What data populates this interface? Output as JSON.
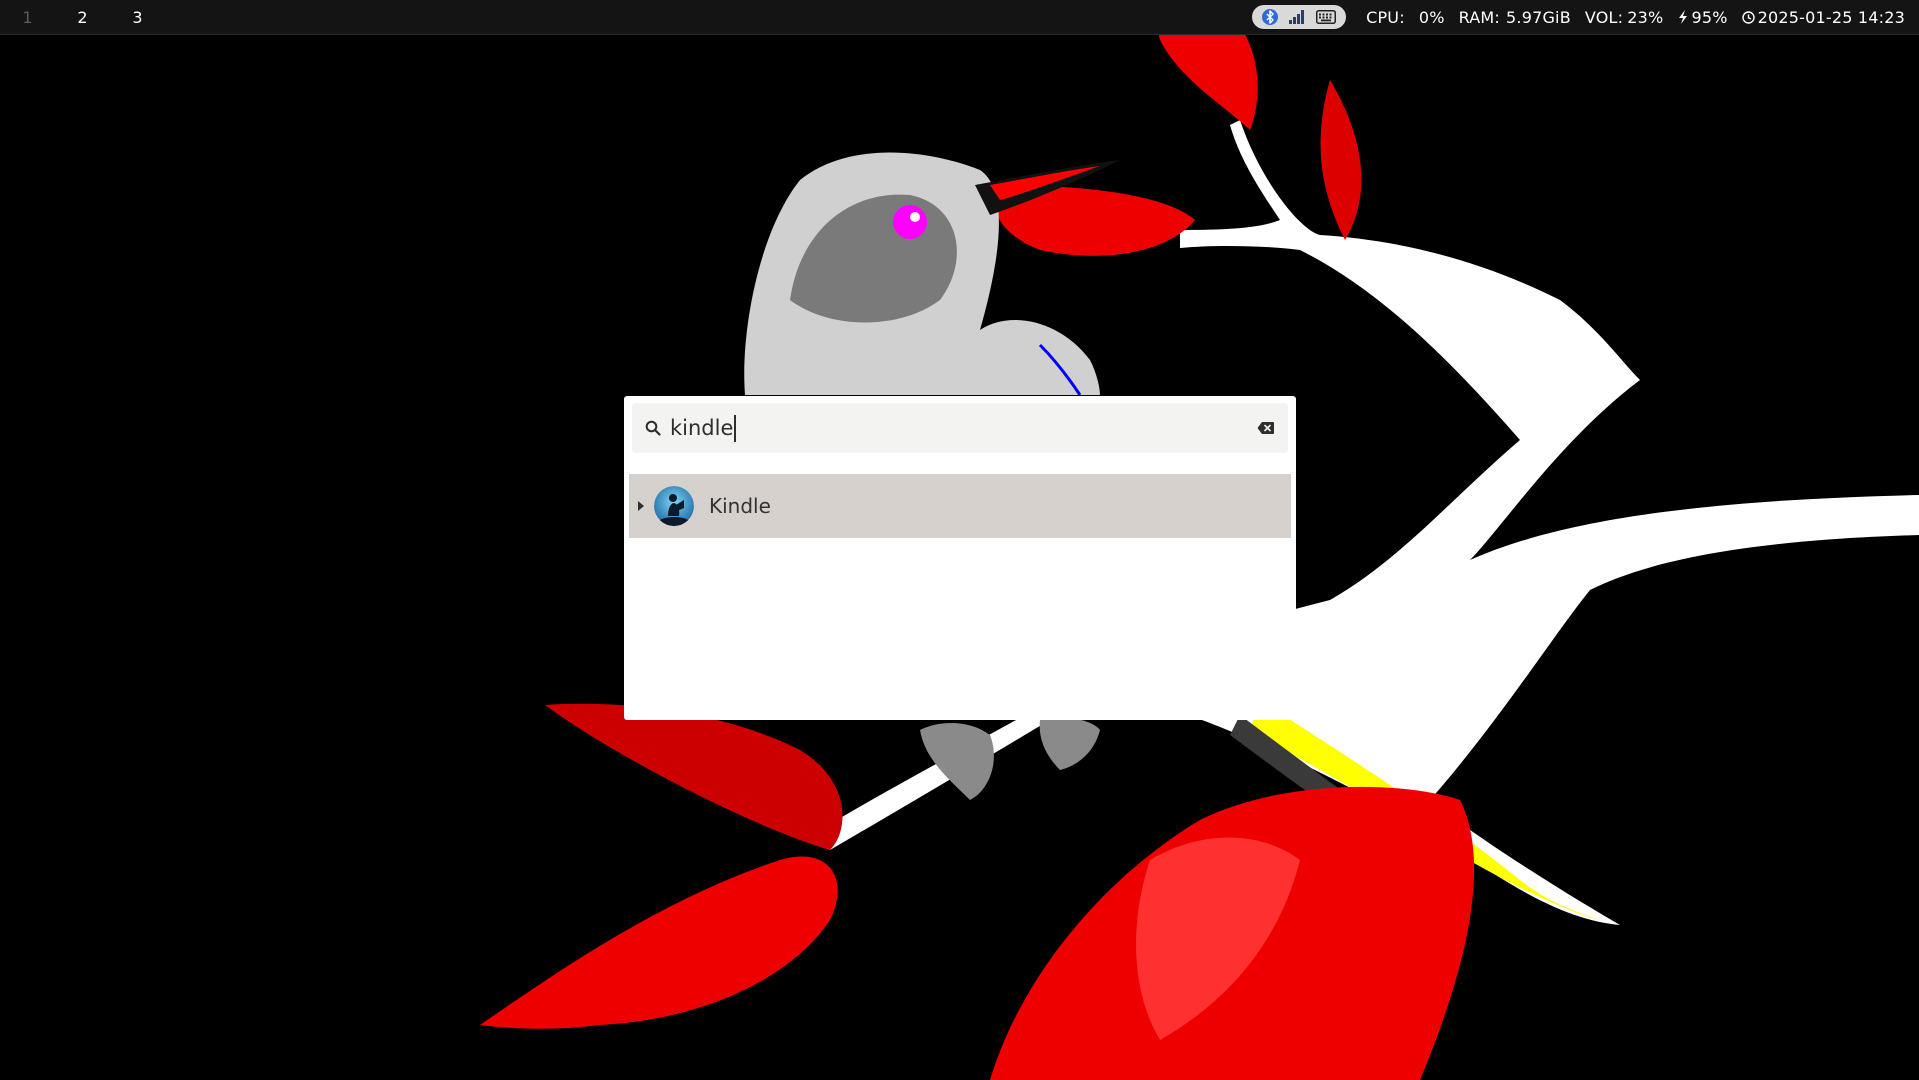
{
  "topbar": {
    "workspaces": [
      {
        "label": "1",
        "active": false
      },
      {
        "label": "2",
        "active": true
      },
      {
        "label": "3",
        "active": true
      }
    ],
    "tray_icons": [
      "bluetooth-icon",
      "network-signal-icon",
      "keyboard-icon"
    ],
    "cpu": {
      "label": "CPU:",
      "value": "0%"
    },
    "ram": {
      "label": "RAM:",
      "value": "5.97GiB"
    },
    "vol": {
      "label": "VOL:",
      "value": "23%"
    },
    "battery": {
      "value": "95%",
      "icon": "charging-icon"
    },
    "clock": {
      "value": "2025-01-25 14:23",
      "icon": "clock-icon"
    }
  },
  "launcher": {
    "search": {
      "query": "kindle",
      "icon": "search-icon",
      "clear_icon": "clear-icon"
    },
    "results": [
      {
        "name": "Kindle",
        "icon": "kindle-app-icon",
        "selected": true
      }
    ]
  },
  "colors": {
    "bar_background": "#141414",
    "launcher_background": "#ffffff",
    "search_background": "#f3f3f2",
    "selected_row": "#d6d1cd",
    "wallpaper_red": "#ff0000",
    "wallpaper_magenta_eye": "#ff00ff"
  }
}
